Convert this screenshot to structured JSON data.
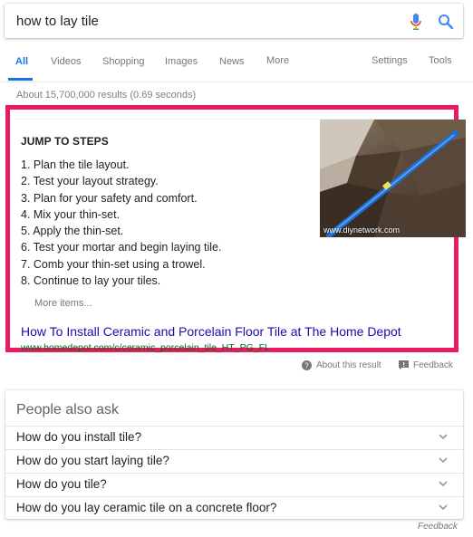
{
  "search": {
    "query": "how to lay tile",
    "placeholder": ""
  },
  "tabs": {
    "items": [
      {
        "label": "All",
        "active": true
      },
      {
        "label": "Videos"
      },
      {
        "label": "Shopping"
      },
      {
        "label": "Images"
      },
      {
        "label": "News"
      },
      {
        "label": "More"
      }
    ],
    "settings": "Settings",
    "tools": "Tools"
  },
  "result_stats": "About 15,700,000 results (0.69 seconds)",
  "snippet": {
    "heading": "JUMP TO STEPS",
    "steps": [
      "1. Plan the tile layout.",
      "2. Test your layout strategy.",
      "3. Plan for your safety and comfort.",
      "4. Mix your thin-set.",
      "5. Apply the thin-set.",
      "6. Test your mortar and begin laying tile.",
      "7. Comb your thin-set using a trowel.",
      "8. Continue to lay your tiles."
    ],
    "more_items": "More items...",
    "image_caption": "www.diynetwork.com",
    "link_title": "How To Install Ceramic and Porcelain Floor Tile at The Home Depot",
    "url": "www.homedepot.com/c/ceramic_porcelain_tile_HT_PG_FL",
    "highlight_color": "#ea1b5f"
  },
  "about_result": "About this result",
  "feedback": "Feedback",
  "people_also_ask": {
    "title": "People also ask",
    "questions": [
      "How do you install tile?",
      "How do you start laying tile?",
      "How do you tile?",
      "How do you lay ceramic tile on a concrete floor?"
    ]
  },
  "feedback_bottom": "Feedback",
  "colors": {
    "link": "#1a0dab",
    "url": "#006621",
    "accent": "#1a73e8"
  }
}
